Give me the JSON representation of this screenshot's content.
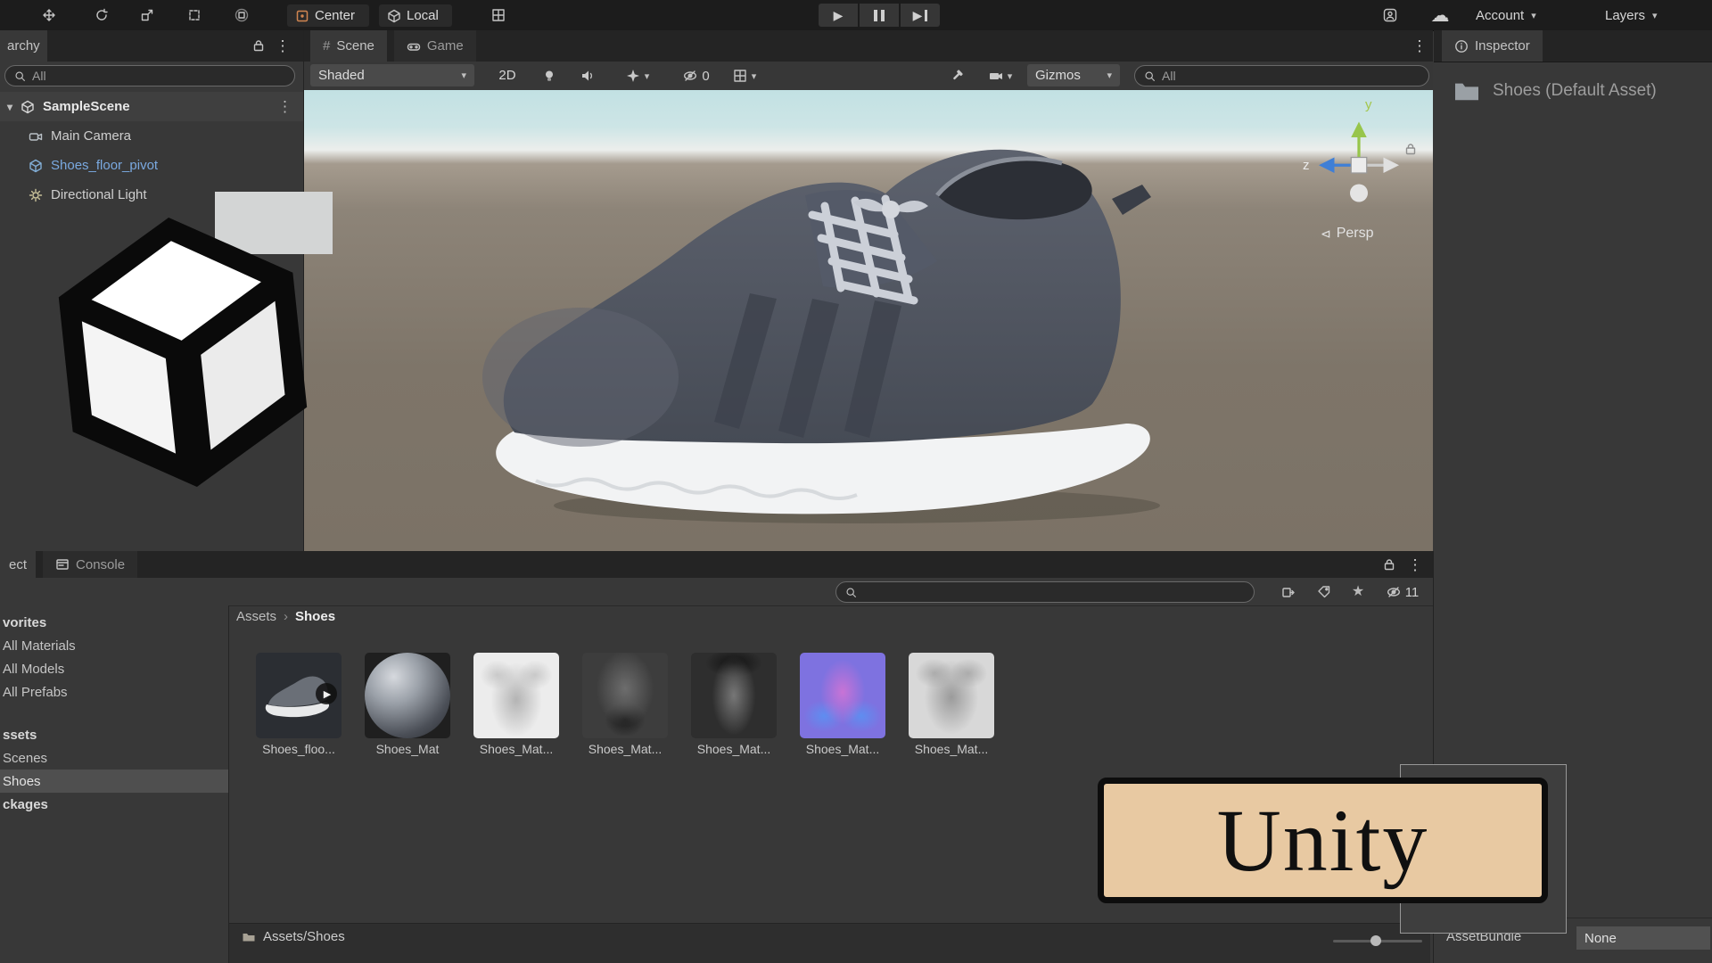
{
  "top_toolbar": {
    "center_label": "Center",
    "local_label": "Local",
    "account_label": "Account",
    "layers_label": "Layers"
  },
  "hierarchy": {
    "tab_label": "archy",
    "search_value": "All",
    "scene_name": "SampleScene",
    "items": [
      {
        "label": "Main Camera"
      },
      {
        "label": "Shoes_floor_pivot"
      },
      {
        "label": "Directional Light"
      }
    ]
  },
  "scene_view": {
    "tab_scene": "Scene",
    "tab_game": "Game",
    "shading_mode": "Shaded",
    "toggle_2d": "2D",
    "hidden_count": "0",
    "gizmos_label": "Gizmos",
    "search_value": "All",
    "axis_y": "y",
    "axis_z": "z",
    "projection_label": "Persp"
  },
  "project": {
    "tab_project": "ect",
    "tab_console": "Console",
    "sidebar_items": [
      "vorites",
      "All Materials",
      "All Models",
      "All Prefabs",
      "ssets",
      "Scenes",
      "Shoes",
      "ckages"
    ],
    "breadcrumb_root": "Assets",
    "breadcrumb_sep": "›",
    "breadcrumb_current": "Shoes",
    "hidden_count": "11",
    "assets": [
      {
        "label": "Shoes_floo..."
      },
      {
        "label": "Shoes_Mat"
      },
      {
        "label": "Shoes_Mat..."
      },
      {
        "label": "Shoes_Mat..."
      },
      {
        "label": "Shoes_Mat..."
      },
      {
        "label": "Shoes_Mat..."
      },
      {
        "label": "Shoes_Mat..."
      }
    ],
    "footer_path": "Assets/Shoes"
  },
  "inspector": {
    "tab_label": "Inspector",
    "asset_title": "Shoes (Default Asset)",
    "assetbundle_label": "AssetBundle",
    "assetbundle_value": "None"
  },
  "banner": {
    "text": "Unity"
  },
  "colors": {
    "banner_bg": "#e8c9a2",
    "prefab_blue": "#7aa9e0",
    "selection_gray": "#4f4f4f",
    "axis_y_green": "#97c54b",
    "axis_z_blue": "#3f7fd6"
  }
}
